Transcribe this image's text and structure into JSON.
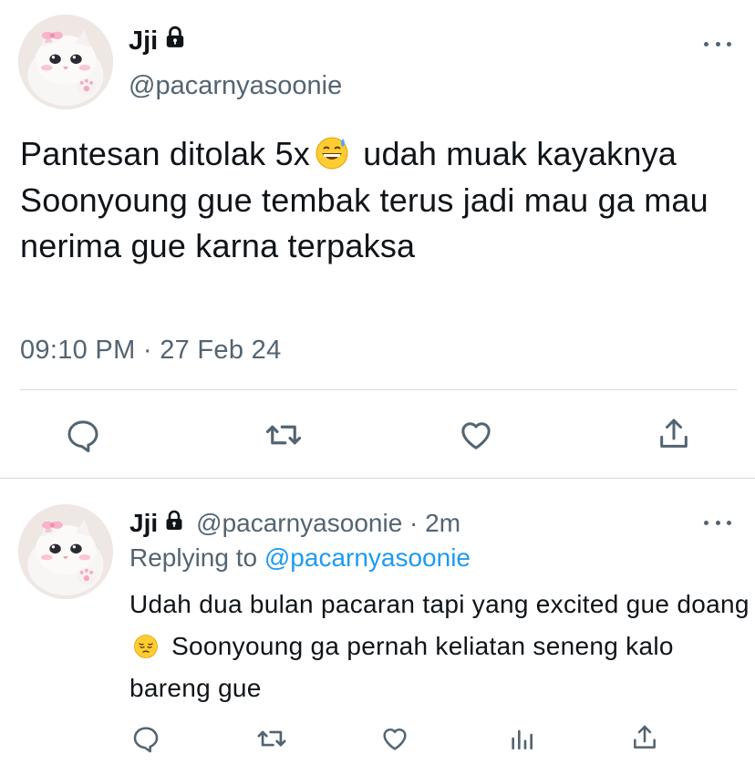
{
  "main_tweet": {
    "display_name": "Jji",
    "handle": "@pacarnyasoonie",
    "text_before_emoji": "Pantesan ditolak 5x",
    "emoji": "grinning-sweat-emoji",
    "text_after_emoji": " udah muak kayaknya Soonyoung gue tembak terus jadi mau ga mau nerima gue karna terpaksa",
    "timestamp": "09:10 PM · 27 Feb 24",
    "actions": [
      "reply-icon",
      "retweet-icon",
      "like-icon",
      "share-icon"
    ]
  },
  "reply_tweet": {
    "display_name": "Jji",
    "meta": "@pacarnyasoonie · 2m",
    "replying_prefix": "Replying to ",
    "replying_to": "@pacarnyasoonie",
    "text_before_emoji": "Udah dua bulan pacaran tapi yang excited gue doang",
    "emoji": "pensive-emoji",
    "text_after_emoji": " Soonyoung ga pernah keliatan seneng kalo bareng gue",
    "actions": [
      "reply-icon",
      "retweet-icon",
      "like-icon",
      "analytics-icon",
      "share-icon"
    ]
  },
  "colors": {
    "text": "#0f1419",
    "secondary": "#536471",
    "link": "#1d9bf0",
    "divider": "#cfd9de"
  }
}
